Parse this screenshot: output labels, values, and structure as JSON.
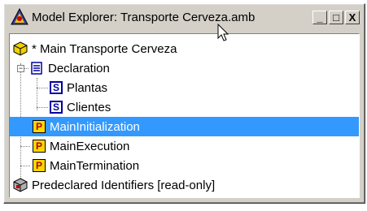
{
  "window": {
    "title": "Model Explorer: Transporte Cerveza.amb",
    "controls": {
      "minimize": "_",
      "maximize": "□",
      "close": "X"
    }
  },
  "tree": {
    "root": {
      "label": "* Main Transporte Cerveza",
      "icon": "cube-icon"
    },
    "declaration": {
      "label": "Declaration",
      "icon": "declaration-icon",
      "expander": "−"
    },
    "declaration_children": [
      {
        "label": "Plantas",
        "badge": "S"
      },
      {
        "label": "Clientes",
        "badge": "S"
      }
    ],
    "procedures": [
      {
        "label": "MainInitialization",
        "badge": "P",
        "selected": true
      },
      {
        "label": "MainExecution",
        "badge": "P",
        "selected": false
      },
      {
        "label": "MainTermination",
        "badge": "P",
        "selected": false
      }
    ],
    "predeclared": {
      "label": "Predeclared Identifiers [read-only]",
      "icon": "predeclared-icon"
    }
  },
  "colors": {
    "selection": "#3399ff",
    "window_bg": "#d4d0c8"
  }
}
